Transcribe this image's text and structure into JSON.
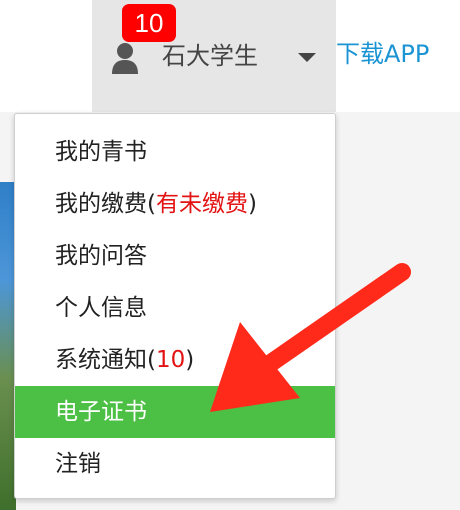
{
  "header": {
    "notification_count": "10",
    "username": "石大学生",
    "download_link": "下载APP"
  },
  "menu": {
    "items": [
      {
        "label": "我的青书"
      },
      {
        "label": "我的缴费",
        "open_paren": "(",
        "note": "有未缴费",
        "close_paren": ")"
      },
      {
        "label": "我的问答"
      },
      {
        "label": "个人信息"
      },
      {
        "label": "系统通知",
        "open_paren": "(",
        "note": "10",
        "close_paren": ")"
      },
      {
        "label": "电子证书"
      },
      {
        "label": "注销"
      }
    ],
    "active_label": "电子证书"
  },
  "icons": {
    "user": "user-icon",
    "dropdown": "caret-down-icon",
    "annotation": "arrow-icon"
  },
  "colors": {
    "badge": "#ff0000",
    "link": "#1b94d4",
    "active": "#4cbf45",
    "alert_text": "#e31313",
    "annotation_arrow": "#ff2a1a"
  }
}
